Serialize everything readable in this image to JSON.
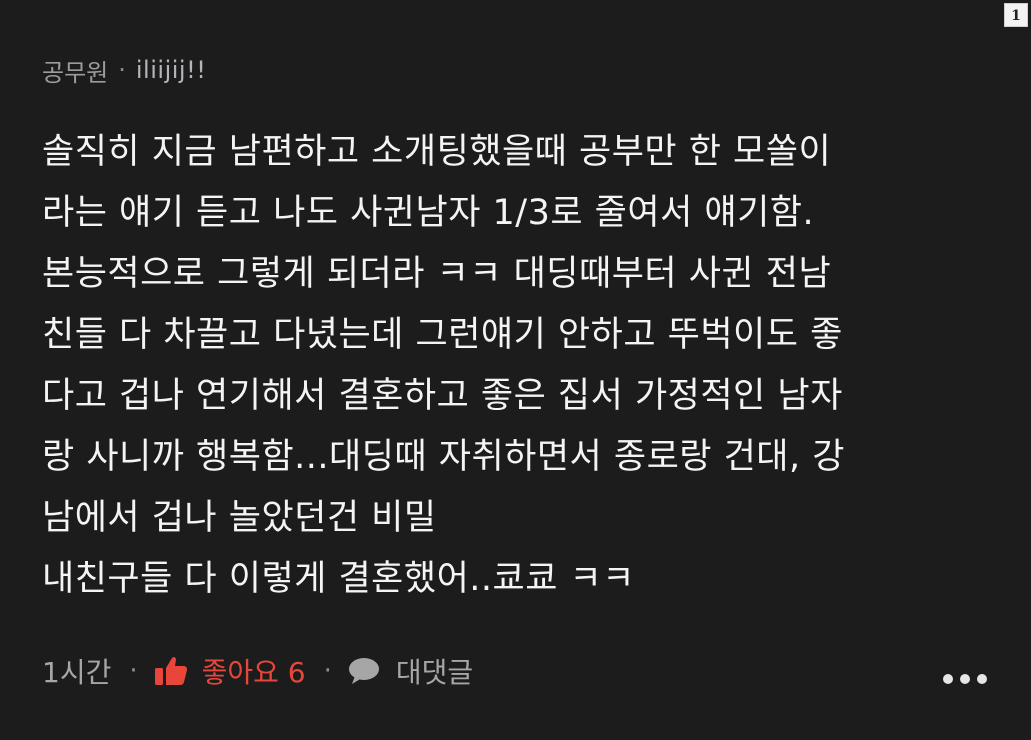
{
  "page_number": "1",
  "comment": {
    "author": "공무원",
    "separator": "·",
    "handle": "iliijij!!",
    "lines": [
      "솔직히 지금 남편하고 소개팅했을때 공부만 한 모쏠이",
      "라는 얘기 듣고 나도 사귄남자 1/3로 줄여서 얘기함.",
      "본능적으로 그렇게 되더라 ㅋㅋ 대딩때부터 사귄 전남",
      "친들 다 차끌고 다녔는데 그런얘기 안하고 뚜벅이도 좋",
      "다고 겁나 연기해서 결혼하고 좋은 집서 가정적인 남자",
      "랑 사니까 행복함...대딩때 자취하면서 종로랑 건대, 강",
      "남에서 겁나 놀았던건 비밀",
      "내친구들 다 이렇게 결혼했어..쿄쿄 ㅋㅋ"
    ]
  },
  "footer": {
    "time": "1시간",
    "separator": "·",
    "like_label": "좋아요 6",
    "reply_label": "대댓글"
  },
  "icons": {
    "like": "thumbs-up-icon",
    "reply": "speech-bubble-icon",
    "more": "more-dots-icon"
  },
  "colors": {
    "background": "#1c1c1c",
    "text": "#f4f4f4",
    "muted": "#9c9c9c",
    "like": "#e8463a"
  }
}
